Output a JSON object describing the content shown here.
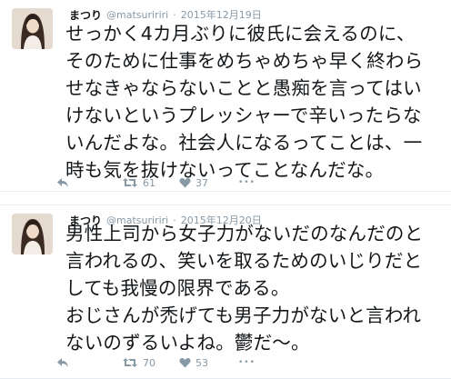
{
  "tweets": [
    {
      "name": "まつり",
      "handle": "@matsuririri",
      "separator": "·",
      "date": "2015年12月19日",
      "lines": [
        "せっかく4カ月ぶりに彼氏に会えるのに、",
        "そのために仕事をめちゃめちゃ早く終わら",
        "せなきゃならないことと愚痴を言ってはい",
        "けないというプレッシャーで辛いったらな",
        "いんだよな。社会人になるってことは、一",
        "時も気を抜けないってことなんだな。"
      ],
      "retweets": "61",
      "likes": "37",
      "more": "•••"
    },
    {
      "name": "まつり",
      "handle": "@matsuririri",
      "separator": "·",
      "date": "2015年12月20日",
      "lines": [
        "男性上司から女子力がないだのなんだのと",
        "言われるの、笑いを取るためのいじりだと",
        "しても我慢の限界である。",
        "おじさんが禿げても男子力がないと言われ",
        "ないのずるいよね。鬱だ〜。"
      ],
      "retweets": "70",
      "likes": "53",
      "more": "•••"
    }
  ],
  "icons": {
    "reply": "reply-icon",
    "retweet": "retweet-icon",
    "like": "heart-icon",
    "more": "more-icon"
  },
  "colors": {
    "text": "#14171a",
    "meta": "#8899a6",
    "divider": "#e6ecf0"
  }
}
